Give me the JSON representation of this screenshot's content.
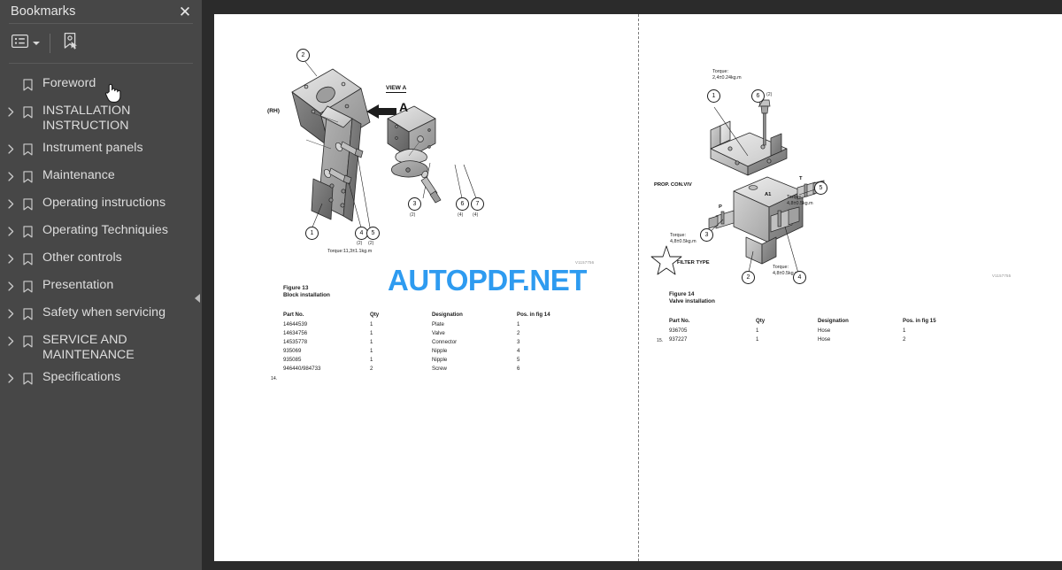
{
  "sidebar": {
    "title": "Bookmarks",
    "close_label": "✕",
    "toolbar": {
      "list_options_icon": "list-options-icon",
      "expand_caret_icon": "chevron-down-icon",
      "new_bookmark_icon": "new-bookmark-icon"
    },
    "items": [
      {
        "label": "Foreword",
        "expandable": false
      },
      {
        "label": "INSTALLATION INSTRUCTION",
        "expandable": true
      },
      {
        "label": "Instrument panels",
        "expandable": true
      },
      {
        "label": "Maintenance",
        "expandable": true
      },
      {
        "label": "Operating instructions",
        "expandable": true
      },
      {
        "label": "Operating Techniquies",
        "expandable": true
      },
      {
        "label": "Other controls",
        "expandable": true
      },
      {
        "label": "Presentation",
        "expandable": true
      },
      {
        "label": "Safety when servicing",
        "expandable": true
      },
      {
        "label": "SERVICE AND MAINTENANCE",
        "expandable": true
      },
      {
        "label": "Specifications",
        "expandable": true
      }
    ],
    "collapse_handle_icon": "triangle-left-icon"
  },
  "watermark": {
    "text": "AUTOPDF.NET",
    "color": "#2e9bf0"
  },
  "left_page": {
    "figure_code": "V1157756",
    "figure_number": "Figure 13",
    "figure_caption": "Block installation",
    "rh_label": "(RH)",
    "arrow_label": "A",
    "view_label": "VIEW A",
    "callouts": [
      {
        "id": "2",
        "qty": ""
      },
      {
        "id": "1",
        "qty": ""
      },
      {
        "id": "4",
        "qty": "(2)"
      },
      {
        "id": "5",
        "qty": "(2)"
      },
      {
        "id": "3",
        "qty": "(2)"
      },
      {
        "id": "6",
        "qty": "(4)"
      },
      {
        "id": "7",
        "qty": "(4)"
      }
    ],
    "torque_note": "Torque:11,3±1.1kg.m",
    "table": {
      "headers": [
        "Part No.",
        "Qty",
        "Designation",
        "Pos. in fig 14"
      ],
      "rows": [
        [
          "14644539",
          "1",
          "Plate",
          "1"
        ],
        [
          "14634756",
          "1",
          "Valve",
          "2"
        ],
        [
          "14535778",
          "1",
          "Connector",
          "3"
        ],
        [
          "935069",
          "1",
          "Nipple",
          "4"
        ],
        [
          "935085",
          "1",
          "Nipple",
          "5"
        ],
        [
          "946440/984733",
          "2",
          "Screw",
          "6"
        ]
      ],
      "row_index": "14."
    }
  },
  "right_page": {
    "figure_code": "V1157755",
    "figure_number": "Figure 14",
    "figure_caption": "Valve installation",
    "valve_label": "PROP. CON.VlV",
    "port_p": "P",
    "port_t": "T",
    "port_a1": "A1",
    "filter_label": "FILTER TYPE",
    "torque_top": "Torque:\n2,4±0.24kg.m",
    "torque_top_l1": "Torque:",
    "torque_top_l2": "2,4±0.24kg.m",
    "torque_right_l1": "Torque:",
    "torque_right_l2": "4,8±0.5kg.m",
    "torque_left_l1": "Torque:",
    "torque_left_l2": "4,8±0.5kg.m",
    "torque_bottom_l1": "Torque:",
    "torque_bottom_l2": "4,8±0.5kg.m",
    "callouts": [
      {
        "id": "1",
        "qty": ""
      },
      {
        "id": "6",
        "qty": "(2)"
      },
      {
        "id": "5",
        "qty": ""
      },
      {
        "id": "3",
        "qty": ""
      },
      {
        "id": "2",
        "qty": ""
      },
      {
        "id": "4",
        "qty": ""
      }
    ],
    "table": {
      "headers": [
        "Part No.",
        "Qty",
        "Designation",
        "Pos. in fig 15"
      ],
      "rows": [
        [
          "936705",
          "1",
          "Hose",
          "1"
        ],
        [
          "937227",
          "1",
          "Hose",
          "2"
        ]
      ],
      "row_index": "15."
    }
  }
}
